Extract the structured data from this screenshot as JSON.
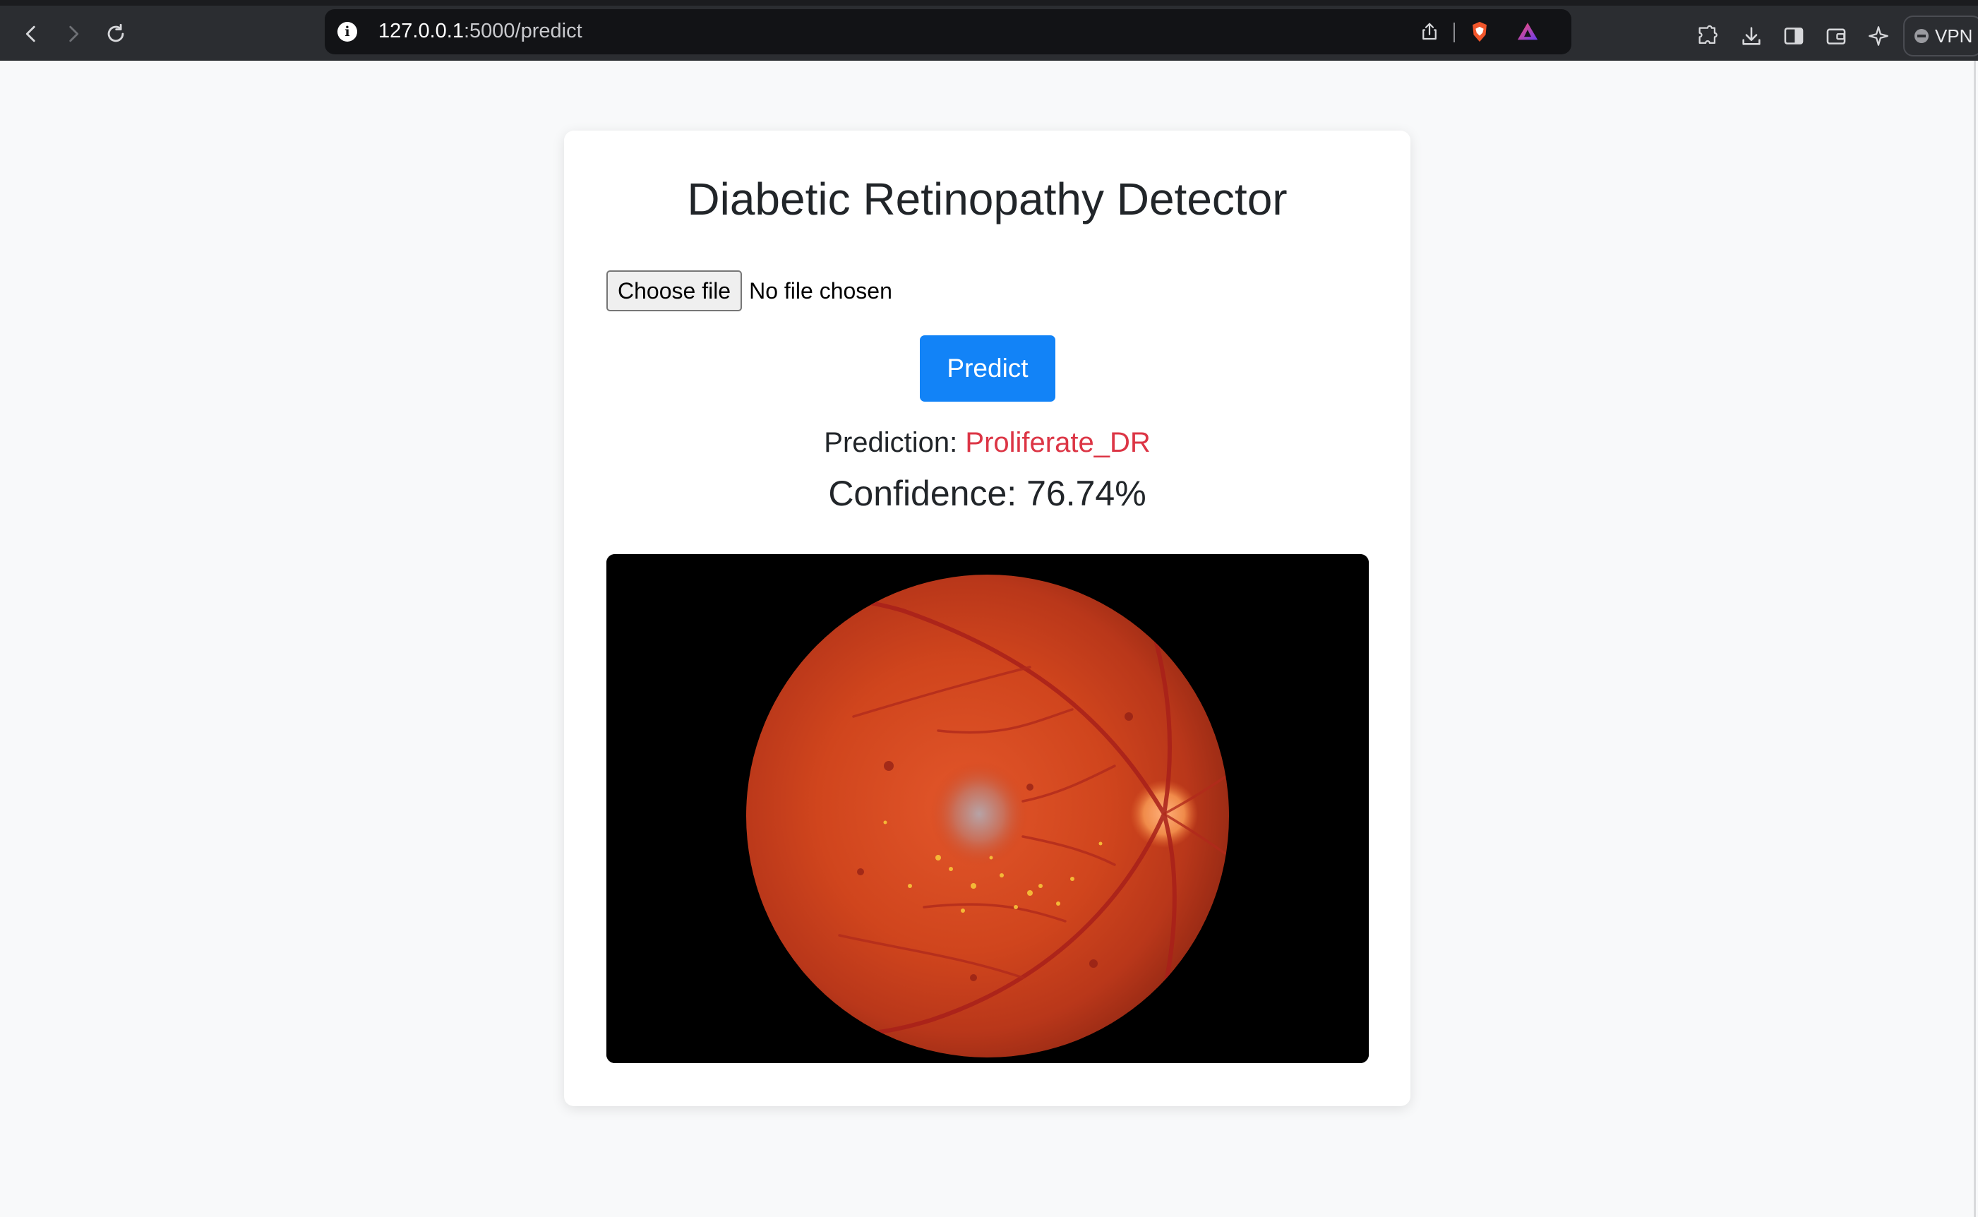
{
  "browser": {
    "url_host": "127.0.0.1",
    "url_path": ":5000/predict",
    "vpn_label": "VPN",
    "icons": [
      "back-icon",
      "forward-icon",
      "reload-icon",
      "site-info-icon",
      "share-icon",
      "brave-shields-icon",
      "brave-rewards-icon",
      "extensions-icon",
      "downloads-icon",
      "sidebar-icon",
      "wallet-icon",
      "leo-ai-icon",
      "vpn-icon"
    ]
  },
  "page": {
    "title": "Diabetic Retinopathy Detector",
    "file_input": {
      "button_label": "Choose file",
      "status": "No file chosen"
    },
    "predict_label": "Predict",
    "prediction_label": "Prediction:",
    "prediction_value": "Proliferate_DR",
    "confidence_text": "Confidence: 76.74%"
  },
  "colors": {
    "chrome_bg": "#2b2d31",
    "page_bg": "#f8f9fa",
    "primary_button": "#1283f7",
    "prediction_value": "#dc3545",
    "text": "#212529"
  }
}
